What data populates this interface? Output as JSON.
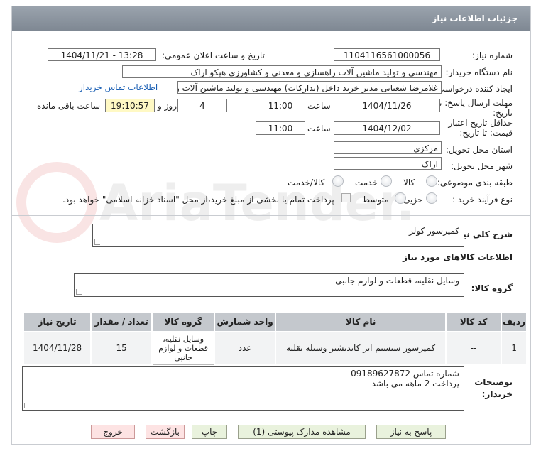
{
  "title": "جزئیات اطلاعات نیاز",
  "form": {
    "need_number_label": "شماره نیاز:",
    "need_number": "1104116561000056",
    "announce_label": "تاریخ و ساعت اعلان عمومی:",
    "announce_value": "1404/11/21 - 13:28",
    "buyer_org_label": "نام دستگاه خریدار:",
    "buyer_org": "مهندسی و تولید ماشین آلات راهسازی و معدنی و کشاورزی هپکو اراک",
    "creator_label": "ایجاد کننده درخواست:",
    "creator": "غلامرضا شعبانی مدیر خرید داخل (تدارکات) مهندسی و تولید ماشین آلات راهسا",
    "contact_link": "اطلاعات تماس خریدار",
    "deadline_label_1": "مهلت ارسال پاسخ: تا",
    "deadline_label_2": "تاریخ:",
    "deadline_date": "1404/11/26",
    "time_label": "ساعت",
    "deadline_time": "11:00",
    "days_value": "4",
    "days_label": "روز و",
    "remaining_time": "19:10:57",
    "remaining_label": "ساعت باقی مانده",
    "min_validity_label_1": "حداقل تاریخ اعتبار",
    "min_validity_label_2": "قیمت: تا تاریخ:",
    "validity_date": "1404/12/02",
    "validity_time": "11:00",
    "province_label": "استان محل تحویل:",
    "province": "مرکزی",
    "city_label": "شهر محل تحویل:",
    "city": "اراک",
    "category_label": "طبقه بندی موضوعی:",
    "category_options": [
      "کالا",
      "خدمت",
      "کالا/خدمت"
    ],
    "process_label": "نوع فرآیند خرید :",
    "process_options": [
      "جزیی",
      "متوسط"
    ],
    "payment_note": "پرداخت تمام یا بخشی از مبلغ خرید،از محل \"اسناد خزانه اسلامی\" خواهد بود."
  },
  "summary_label": "شرح کلی نیاز:",
  "summary": "کمپرسور کولر",
  "goods_info_title": "اطلاعات کالاهای مورد نیاز",
  "goods_group_label": "گروه کالا:",
  "goods_group": "وسایل نقلیه، قطعات و لوازم جانبی",
  "table": {
    "headers": [
      "ردیف",
      "کد کالا",
      "نام کالا",
      "واحد شمارش",
      "گروه کالا",
      "تعداد / مقدار",
      "تاریخ نیاز"
    ],
    "rows": [
      [
        "1",
        "--",
        "کمپرسور سیستم ایر کاندیشنر وسیله نقلیه",
        "عدد",
        "وسایل نقلیه، قطعات و لوازم جانبی",
        "15",
        "1404/11/28"
      ]
    ]
  },
  "buyer_notes_label_1": "توضیحات",
  "buyer_notes_label_2": "خریدار:",
  "buyer_notes_line1": "شماره تماس   09189627872",
  "buyer_notes_line2": "پرداخت 2 ماهه می باشد",
  "buttons": {
    "reply": "پاسخ به نیاز",
    "attachments": "مشاهده مدارک پیوستی (1)",
    "print": "چاپ",
    "back": "بازگشت",
    "exit": "خروج"
  },
  "watermark_text": "AriaTender.neT"
}
